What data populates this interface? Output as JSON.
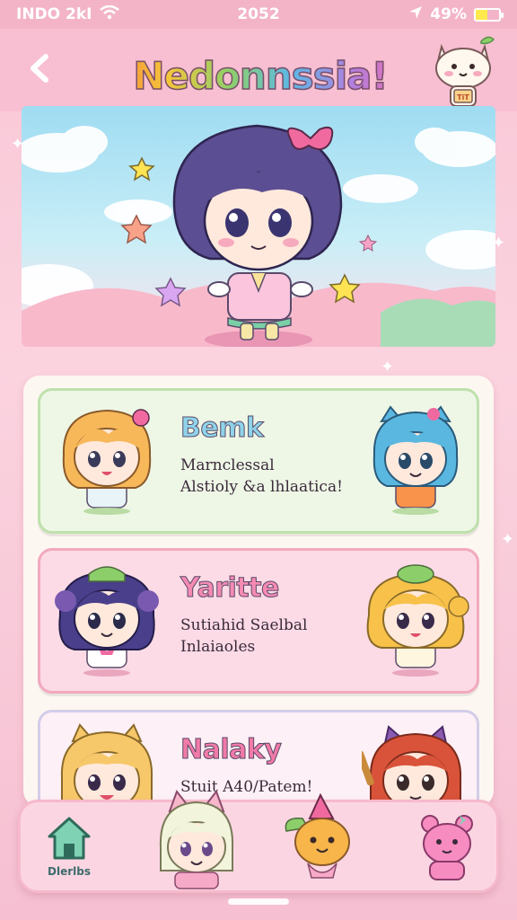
{
  "status_bar": {
    "carrier": "INDO 2kI",
    "time": "2052",
    "battery": "49%",
    "battery_level": 0.49
  },
  "header": {
    "title": "Nedonnssia!",
    "mascot_badge": "TiT"
  },
  "cards": [
    {
      "title": "Bemk",
      "desc_line1": "Marnclessal",
      "desc_line2": "Alstioly &a lhlaatica!"
    },
    {
      "title": "Yaritte",
      "desc_line1": "Sutiahid Saelbal",
      "desc_line2": "Inlaiaoles"
    },
    {
      "title": "Nalaky",
      "desc_line1": "Stuit A40/Patem!",
      "desc_line2": ""
    }
  ],
  "bottom_nav": {
    "home_label": "Dlerlbs"
  },
  "colors": {
    "pink_bg": "#f9c6d6",
    "card_green": "#eef7e6",
    "card_pink": "#fcdbe6",
    "accent_pink": "#f17aa7"
  }
}
